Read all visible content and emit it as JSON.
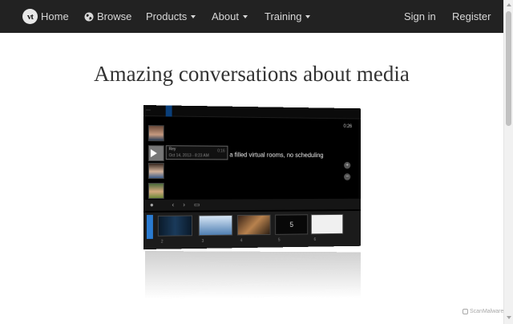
{
  "navbar": {
    "home_label": "Home",
    "browse_label": "Browse",
    "products_label": "Products",
    "about_label": "About",
    "training_label": "Training",
    "signin_label": "Sign in",
    "register_label": "Register",
    "logo_text": "vt",
    "bg_color": "#222222"
  },
  "hero": {
    "title": "Amazing conversations about media"
  },
  "screenshot": {
    "timer": "0:26",
    "caption": "a filled virtual rooms, no scheduling",
    "tooltip_name": "Rey",
    "tooltip_meta": "Oct 14, 2013 - 8:23 AM",
    "tooltip_time": "0:16",
    "slide_label": "5",
    "thumb_numbers": [
      "2",
      "3",
      "4",
      "5",
      "6"
    ]
  },
  "watermark": {
    "label": "ScanMalware"
  }
}
